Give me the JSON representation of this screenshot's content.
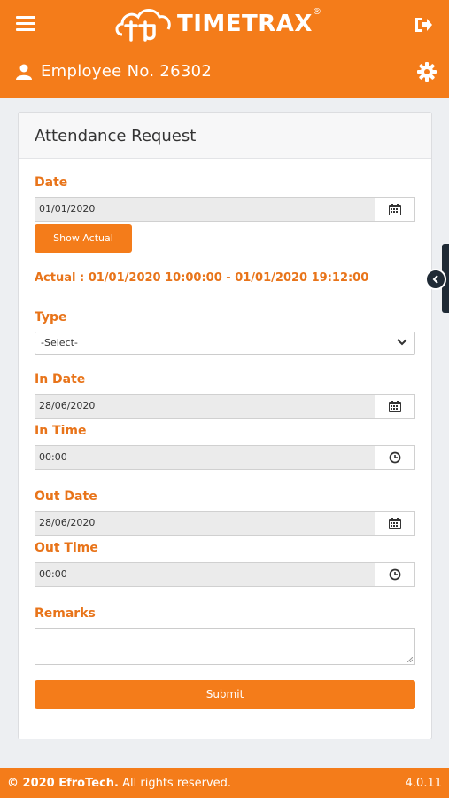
{
  "header": {
    "brand": "TIMETRAX",
    "brand_mark": "®",
    "employee": "Employee No. 26302"
  },
  "card": {
    "title": "Attendance Request",
    "date_label": "Date",
    "date_value": "01/01/2020",
    "show_actual_label": "Show Actual",
    "actual_text": "Actual : 01/01/2020 10:00:00 - 01/01/2020 19:12:00",
    "type_label": "Type",
    "type_selected": "-Select-",
    "in_date_label": "In Date",
    "in_date_value": "28/06/2020",
    "in_time_label": "In Time",
    "in_time_value": "00:00",
    "out_date_label": "Out Date",
    "out_date_value": "28/06/2020",
    "out_time_label": "Out Time",
    "out_time_value": "00:00",
    "remarks_label": "Remarks",
    "remarks_value": "",
    "submit_label": "Submit"
  },
  "footer": {
    "copyright_prefix": "© 2020 ",
    "company": "EfroTech.",
    "rights": " All rights reserved.",
    "version": "4.0.11"
  },
  "colors": {
    "brand_orange": "#f47c1a",
    "label_orange": "#e8741a",
    "side_tab": "#1f2a35"
  },
  "icons": [
    "menu-icon",
    "logo-icon",
    "logout-icon",
    "user-icon",
    "gear-icon",
    "calendar-icon",
    "clock-icon",
    "chevron-down-icon",
    "chevron-left-icon"
  ]
}
